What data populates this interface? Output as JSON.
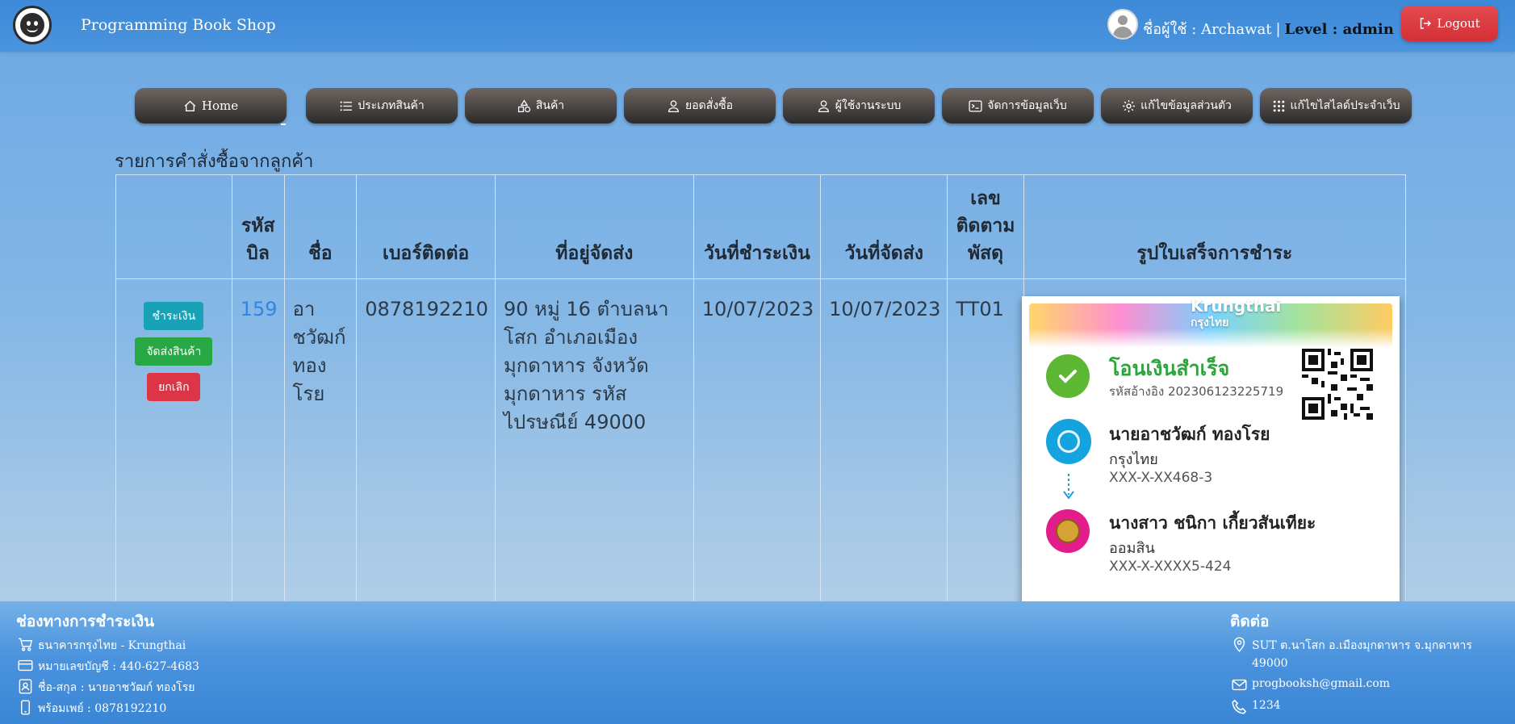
{
  "header": {
    "brand": "Programming Book Shop",
    "user_label": "ชื่อผู้ใช้ : Archawat",
    "separator": "|",
    "level_label": "Level : admin",
    "logout_label": "Logout"
  },
  "nav": {
    "items": [
      {
        "label": "Home",
        "icon": "home-icon"
      },
      {
        "label": "ประเภทสินค้า",
        "icon": "list-icon"
      },
      {
        "label": "สินค้า",
        "icon": "shapes-icon"
      },
      {
        "label": "ยอดสั่งซื้อ",
        "icon": "person-icon"
      },
      {
        "label": "ผู้ใช้งานระบบ",
        "icon": "person-icon"
      },
      {
        "label": "จัดการข้อมูลเว็บ",
        "icon": "terminal-icon"
      },
      {
        "label": "แก้ไขข้อมูลส่วนตัว",
        "icon": "gear-icon"
      },
      {
        "label": "แก้ไขไสไลด์ประจำเว็บ",
        "icon": "grid-icon"
      }
    ]
  },
  "orders": {
    "title": "รายการคำสั่งซื้อจากลูกค้า",
    "headers": [
      "",
      "รหัสบิล",
      "ชื่อ",
      "เบอร์ติดต่อ",
      "ที่อยู่จัดส่ง",
      "วันที่ชำระเงิน",
      "วันที่จัดส่ง",
      "เลขติดตามพัสดุ",
      "รูปใบเสร็จการชำระ"
    ],
    "row": {
      "actions": {
        "pay": "ชำระเงิน",
        "ship": "จัดส่งสินค้า",
        "cancel": "ยกเลิก"
      },
      "bill_id": "159",
      "name": "อาชวัฒก์ ทองโรย",
      "phone": "0878192210",
      "address": "90 หมู่ 16 ตำบลนาโสก อำเภอเมืองมุกดาหาร จังหวัดมุกดาหาร รหัสไปรษณีย์ 49000",
      "pay_date": "10/07/2023",
      "ship_date": "10/07/2023",
      "tracking": "TT01"
    }
  },
  "receipt": {
    "bank_title": "Krungthai",
    "bank_sub": "กรุงไทย",
    "success": "โอนเงินสำเร็จ",
    "ref": "รหัสอ้างอิง 202306123225719",
    "sender_name": "นายอาชวัฒก์ ทองโรย",
    "sender_bank": "กรุงไทย",
    "sender_acct": "XXX-X-XX468-3",
    "receiver_name": "นางสาว ชนิกา เกี้ยวสันเทียะ",
    "receiver_bank": "ออมสิน",
    "receiver_acct": "XXX-X-XXXX5-424"
  },
  "footer": {
    "payment_title": "ช่องทางการชำระเงิน",
    "payment": [
      {
        "icon": "cart-icon",
        "text": "ธนาคารกรุงไทย - Krungthai"
      },
      {
        "icon": "card-icon",
        "text": "หมายเลขบัญชี : 440-627-4683"
      },
      {
        "icon": "contact-card-icon",
        "text": "ชื่อ-สกุล : นายอาชวัฒก์ ทองโรย"
      },
      {
        "icon": "phone-icon",
        "text": "พร้อมเพย์ : 0878192210"
      }
    ],
    "contact_title": "ติดต่อ",
    "contact": [
      {
        "icon": "location-icon",
        "text": "SUT ต.นาโสก อ.เมืองมุกดาหาร จ.มุกดาหาร 49000"
      },
      {
        "icon": "mail-icon",
        "text": "progbooksh@gmail.com"
      },
      {
        "icon": "telephone-icon",
        "text": "1234"
      }
    ]
  }
}
